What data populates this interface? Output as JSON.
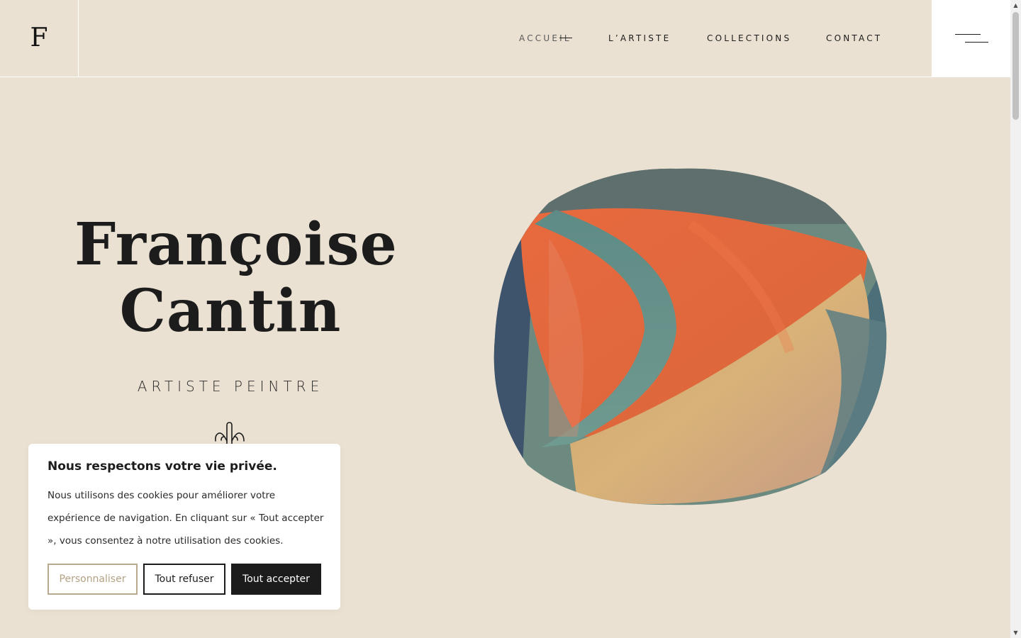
{
  "header": {
    "logo": "F",
    "nav": [
      {
        "label": "ACCUEIL"
      },
      {
        "label": "L’ARTISTE"
      },
      {
        "label": "COLLECTIONS"
      },
      {
        "label": "CONTACT"
      }
    ],
    "menu_icon": "hamburger-icon"
  },
  "hero": {
    "title_line1": "Françoise",
    "title_line2": "Cantin",
    "subtitle": "ARTISTE PEINTRE",
    "scroll_icon": "hand-pointing-down-icon"
  },
  "cookie": {
    "title": "Nous respectons votre vie privée.",
    "text": "Nous utilisons des cookies pour améliorer votre expérience de navigation. En cliquant sur « Tout accepter », vous consentez à notre utilisation des cookies.",
    "customize_label": "Personnaliser",
    "refuse_label": "Tout refuser",
    "accept_label": "Tout accepter"
  },
  "colors": {
    "background": "#eae1d2",
    "text": "#1c1c1c",
    "accent": "#b5a284"
  }
}
